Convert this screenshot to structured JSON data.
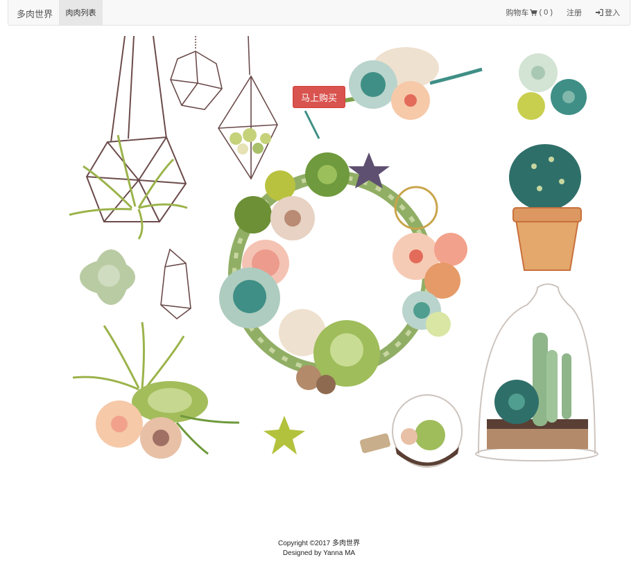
{
  "navbar": {
    "brand": "多肉世界",
    "active_tab": "肉肉列表",
    "cart_label": "购物车",
    "cart_count": "( 0 )",
    "register": "注册",
    "login": "登入"
  },
  "hero": {
    "buy_button": "马上购买"
  },
  "footer": {
    "copyright": "Copyright ©2017 多肉世界",
    "designer": "Designed by Yanna MA"
  },
  "colors": {
    "buy_button": "#d9534f",
    "navbar_bg": "#f8f8f8",
    "leaf_green": "#7e9b3f",
    "teal": "#3f8f86",
    "peach": "#f3b99a",
    "terracotta": "#d98b55",
    "outline": "#6b4a4a"
  }
}
